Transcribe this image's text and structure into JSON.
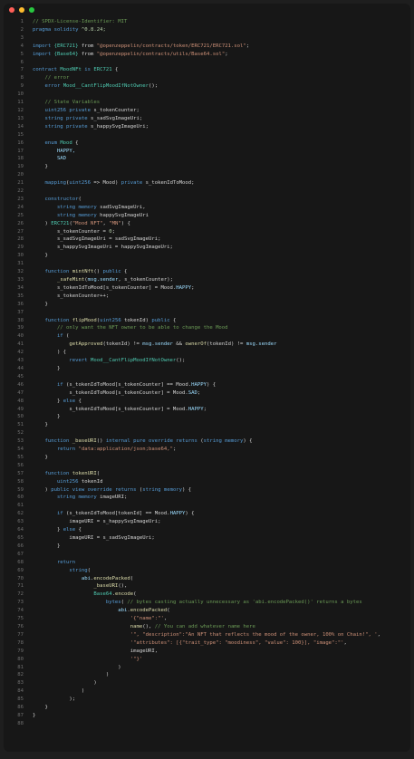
{
  "window": {
    "controls": [
      {
        "name": "close",
        "color": "#ff5f57"
      },
      {
        "name": "minimize",
        "color": "#febc2e"
      },
      {
        "name": "maximize",
        "color": "#28c840"
      }
    ]
  },
  "code": {
    "lines": [
      [
        [
          "// SPDX-License-Identifier: MIT",
          "c"
        ]
      ],
      [
        [
          "pragma solidity ",
          "k"
        ],
        [
          "^0.8.24;",
          "n"
        ]
      ],
      [
        [
          "",
          ""
        ]
      ],
      [
        [
          "import ",
          "k"
        ],
        [
          "{ERC721}",
          "t"
        ],
        [
          " from ",
          ""
        ],
        [
          "\"@openzeppelin/contracts/token/ERC721/ERC721.sol\"",
          "s"
        ],
        [
          ";",
          ""
        ]
      ],
      [
        [
          "import ",
          "k"
        ],
        [
          "{Base64}",
          "t"
        ],
        [
          " from ",
          ""
        ],
        [
          "\"@openzeppelin/contracts/utils/Base64.sol\"",
          "s"
        ],
        [
          ";",
          ""
        ]
      ],
      [
        [
          "",
          ""
        ]
      ],
      [
        [
          "contract ",
          "k"
        ],
        [
          "MoodNFt",
          "t"
        ],
        [
          " is ",
          "k"
        ],
        [
          "ERC721",
          "t"
        ],
        [
          " {",
          ""
        ]
      ],
      [
        [
          "    // error",
          "c"
        ]
      ],
      [
        [
          "    error ",
          "k"
        ],
        [
          "Mood__CantFlipMoodIfNotOwner",
          "t"
        ],
        [
          "();",
          ""
        ]
      ],
      [
        [
          "",
          ""
        ]
      ],
      [
        [
          "    // State Variables",
          "c"
        ]
      ],
      [
        [
          "    uint256 private ",
          "k"
        ],
        [
          "s_tokenCounter;",
          ""
        ]
      ],
      [
        [
          "    string private ",
          "k"
        ],
        [
          "s_sadSvgImageUri;",
          ""
        ]
      ],
      [
        [
          "    string private ",
          "k"
        ],
        [
          "s_happySvgImageUri;",
          ""
        ]
      ],
      [
        [
          "",
          ""
        ]
      ],
      [
        [
          "    enum ",
          "k"
        ],
        [
          "Mood",
          "t"
        ],
        [
          " {",
          ""
        ]
      ],
      [
        [
          "        HAPPY,",
          "v"
        ]
      ],
      [
        [
          "        SAD",
          "v"
        ]
      ],
      [
        [
          "    }",
          ""
        ]
      ],
      [
        [
          "",
          ""
        ]
      ],
      [
        [
          "    mapping",
          "k"
        ],
        [
          "(",
          ""
        ],
        [
          "uint256",
          "k"
        ],
        [
          " => Mood) ",
          ""
        ],
        [
          "private ",
          "k"
        ],
        [
          "s_tokenIdToMood;",
          ""
        ]
      ],
      [
        [
          "",
          ""
        ]
      ],
      [
        [
          "    constructor",
          "k"
        ],
        [
          "(",
          ""
        ]
      ],
      [
        [
          "        string memory ",
          "k"
        ],
        [
          "sadSvgImageUri,",
          ""
        ]
      ],
      [
        [
          "        string memory ",
          "k"
        ],
        [
          "happySvgImageUri",
          ""
        ]
      ],
      [
        [
          "    ) ",
          ""
        ],
        [
          "ERC721",
          "t"
        ],
        [
          "(",
          ""
        ],
        [
          "\"Mood NFT\"",
          "s"
        ],
        [
          ", ",
          ""
        ],
        [
          "\"MN\"",
          "s"
        ],
        [
          ") {",
          ""
        ]
      ],
      [
        [
          "        s_tokenCounter = ",
          ""
        ],
        [
          "0",
          "n"
        ],
        [
          ";",
          ""
        ]
      ],
      [
        [
          "        s_sadSvgImageUri = sadSvgImageUri;",
          ""
        ]
      ],
      [
        [
          "        s_happySvgImageUri = happySvgImageUri;",
          ""
        ]
      ],
      [
        [
          "    }",
          ""
        ]
      ],
      [
        [
          "",
          ""
        ]
      ],
      [
        [
          "    function ",
          "k"
        ],
        [
          "mintNft",
          "f"
        ],
        [
          "() ",
          ""
        ],
        [
          "public ",
          "k"
        ],
        [
          "{",
          ""
        ]
      ],
      [
        [
          "        ",
          ""
        ],
        [
          "_safeMint",
          "f"
        ],
        [
          "(",
          ""
        ],
        [
          "msg.sender",
          "v"
        ],
        [
          ", s_tokenCounter);",
          ""
        ]
      ],
      [
        [
          "        s_tokenIdToMood[s_tokenCounter] = Mood.",
          ""
        ],
        [
          "HAPPY",
          "v"
        ],
        [
          ";",
          ""
        ]
      ],
      [
        [
          "        s_tokenCounter++;",
          ""
        ]
      ],
      [
        [
          "    }",
          ""
        ]
      ],
      [
        [
          "",
          ""
        ]
      ],
      [
        [
          "    function ",
          "k"
        ],
        [
          "flipMood",
          "f"
        ],
        [
          "(",
          ""
        ],
        [
          "uint256 ",
          "k"
        ],
        [
          "tokenId) ",
          ""
        ],
        [
          "public ",
          "k"
        ],
        [
          "{",
          ""
        ]
      ],
      [
        [
          "        // only want the NFT owner to be able to change the Mood",
          "c"
        ]
      ],
      [
        [
          "        if ",
          "k"
        ],
        [
          "(",
          ""
        ]
      ],
      [
        [
          "            ",
          ""
        ],
        [
          "getApproved",
          "f"
        ],
        [
          "(tokenId) != ",
          ""
        ],
        [
          "msg.sender",
          "v"
        ],
        [
          " && ",
          ""
        ],
        [
          "ownerOf",
          "f"
        ],
        [
          "(tokenId) != ",
          ""
        ],
        [
          "msg.sender",
          "v"
        ]
      ],
      [
        [
          "        ) {",
          ""
        ]
      ],
      [
        [
          "            revert ",
          "k"
        ],
        [
          "Mood__CantFlipMoodIfNotOwner",
          "t"
        ],
        [
          "();",
          ""
        ]
      ],
      [
        [
          "        }",
          ""
        ]
      ],
      [
        [
          "",
          ""
        ]
      ],
      [
        [
          "        if ",
          "k"
        ],
        [
          "(s_tokenIdToMood[s_tokenCounter] == Mood.",
          ""
        ],
        [
          "HAPPY",
          "v"
        ],
        [
          ") {",
          ""
        ]
      ],
      [
        [
          "            s_tokenIdToMood[s_tokenCounter] = Mood.",
          ""
        ],
        [
          "SAD",
          "v"
        ],
        [
          ";",
          ""
        ]
      ],
      [
        [
          "        } ",
          ""
        ],
        [
          "else ",
          "k"
        ],
        [
          "{",
          ""
        ]
      ],
      [
        [
          "            s_tokenIdToMood[s_tokenCounter] = Mood.",
          ""
        ],
        [
          "HAPPY",
          "v"
        ],
        [
          ";",
          ""
        ]
      ],
      [
        [
          "        }",
          ""
        ]
      ],
      [
        [
          "    }",
          ""
        ]
      ],
      [
        [
          "",
          ""
        ]
      ],
      [
        [
          "    function ",
          "k"
        ],
        [
          "_baseURI",
          "f"
        ],
        [
          "() ",
          ""
        ],
        [
          "internal pure override returns ",
          "k"
        ],
        [
          "(",
          ""
        ],
        [
          "string memory",
          "k"
        ],
        [
          ") {",
          ""
        ]
      ],
      [
        [
          "        return ",
          "k"
        ],
        [
          "\"data:application/json;base64,\"",
          "s"
        ],
        [
          ";",
          ""
        ]
      ],
      [
        [
          "    }",
          ""
        ]
      ],
      [
        [
          "",
          ""
        ]
      ],
      [
        [
          "    function ",
          "k"
        ],
        [
          "tokenURI",
          "f"
        ],
        [
          "(",
          ""
        ]
      ],
      [
        [
          "        uint256 ",
          "k"
        ],
        [
          "tokenId",
          ""
        ]
      ],
      [
        [
          "    ) ",
          ""
        ],
        [
          "public view override returns ",
          "k"
        ],
        [
          "(",
          ""
        ],
        [
          "string memory",
          "k"
        ],
        [
          ") {",
          ""
        ]
      ],
      [
        [
          "        string memory ",
          "k"
        ],
        [
          "imageURI;",
          ""
        ]
      ],
      [
        [
          "",
          ""
        ]
      ],
      [
        [
          "        if ",
          "k"
        ],
        [
          "(s_tokenIdToMood[tokenId] == Mood.",
          ""
        ],
        [
          "HAPPY",
          "v"
        ],
        [
          ") {",
          ""
        ]
      ],
      [
        [
          "            imageURI = s_happySvgImageUri;",
          ""
        ]
      ],
      [
        [
          "        } ",
          ""
        ],
        [
          "else ",
          "k"
        ],
        [
          "{",
          ""
        ]
      ],
      [
        [
          "            imageURI = s_sadSvgImageUri;",
          ""
        ]
      ],
      [
        [
          "        }",
          ""
        ]
      ],
      [
        [
          "",
          ""
        ]
      ],
      [
        [
          "        return",
          "k"
        ]
      ],
      [
        [
          "            ",
          ""
        ],
        [
          "string",
          "k"
        ],
        [
          "(",
          ""
        ]
      ],
      [
        [
          "                ",
          ""
        ],
        [
          "abi",
          "v"
        ],
        [
          ".",
          ""
        ],
        [
          "encodePacked",
          "f"
        ],
        [
          "(",
          ""
        ]
      ],
      [
        [
          "                    ",
          ""
        ],
        [
          "_baseURI",
          "f"
        ],
        [
          "(),",
          ""
        ]
      ],
      [
        [
          "                    ",
          ""
        ],
        [
          "Base64",
          "t"
        ],
        [
          ".",
          ""
        ],
        [
          "encode",
          "f"
        ],
        [
          "(",
          ""
        ]
      ],
      [
        [
          "                        ",
          ""
        ],
        [
          "bytes",
          "k"
        ],
        [
          "( ",
          ""
        ],
        [
          "// bytes casting actually unnecessary as 'abi.encodePacked()' returns a bytes",
          "c"
        ]
      ],
      [
        [
          "                            ",
          ""
        ],
        [
          "abi",
          "v"
        ],
        [
          ".",
          ""
        ],
        [
          "encodePacked",
          "f"
        ],
        [
          "(",
          ""
        ]
      ],
      [
        [
          "                                ",
          ""
        ],
        [
          "'{\"name\":\"'",
          "s"
        ],
        [
          ",",
          ""
        ]
      ],
      [
        [
          "                                ",
          ""
        ],
        [
          "name",
          "f"
        ],
        [
          "(), ",
          ""
        ],
        [
          "// You can add whatever name here",
          "c"
        ]
      ],
      [
        [
          "                                ",
          ""
        ],
        [
          "'\", \"description\":\"An NFT that reflects the mood of the owner, 100% on Chain!\", '",
          "s"
        ],
        [
          ",",
          ""
        ]
      ],
      [
        [
          "                                ",
          ""
        ],
        [
          "'\"attributes\": [{\"trait_type\": \"moodiness\", \"value\": 100}], \"image\":\"'",
          "s"
        ],
        [
          ",",
          ""
        ]
      ],
      [
        [
          "                                imageURI,",
          ""
        ]
      ],
      [
        [
          "                                ",
          ""
        ],
        [
          "'\"}'",
          "s"
        ]
      ],
      [
        [
          "                            )",
          ""
        ]
      ],
      [
        [
          "                        )",
          ""
        ]
      ],
      [
        [
          "                    )",
          ""
        ]
      ],
      [
        [
          "                )",
          ""
        ]
      ],
      [
        [
          "            );",
          ""
        ]
      ],
      [
        [
          "    }",
          ""
        ]
      ],
      [
        [
          "}",
          ""
        ]
      ],
      [
        [
          "",
          ""
        ]
      ]
    ]
  }
}
